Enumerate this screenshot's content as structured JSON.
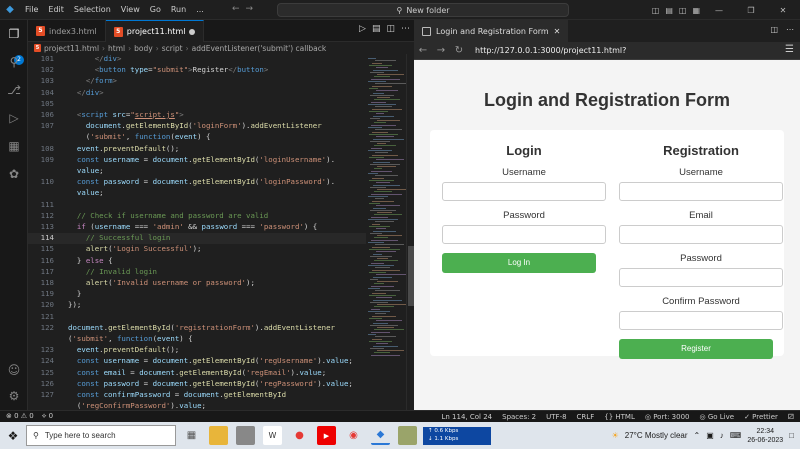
{
  "titlebar": {
    "menu": [
      "File",
      "Edit",
      "Selection",
      "View",
      "Go",
      "Run",
      "..."
    ],
    "search": "New folder"
  },
  "tabs": [
    {
      "label": "index3.html"
    },
    {
      "label": "project11.html"
    }
  ],
  "breadcrumb": [
    "project11.html",
    "html",
    "body",
    "script",
    "addEventListener('submit') callback"
  ],
  "code": {
    "lines": [
      {
        "n": "101",
        "t": ""
      },
      {
        "n": "102",
        "t": ""
      },
      {
        "n": "103",
        "t": ""
      },
      {
        "n": "104",
        "t": ""
      },
      {
        "n": "105",
        "t": ""
      },
      {
        "n": "106",
        "t": ""
      },
      {
        "n": "107",
        "t": ""
      },
      {
        "n": "",
        "t": ""
      },
      {
        "n": "108",
        "t": ""
      },
      {
        "n": "109",
        "t": ""
      },
      {
        "n": "",
        "t": ""
      },
      {
        "n": "110",
        "t": ""
      },
      {
        "n": "",
        "t": ""
      },
      {
        "n": "111",
        "t": ""
      },
      {
        "n": "112",
        "t": ""
      },
      {
        "n": "113",
        "t": ""
      },
      {
        "n": "114",
        "t": ""
      },
      {
        "n": "115",
        "t": ""
      },
      {
        "n": "116",
        "t": ""
      },
      {
        "n": "117",
        "t": ""
      },
      {
        "n": "118",
        "t": ""
      },
      {
        "n": "119",
        "t": ""
      },
      {
        "n": "120",
        "t": ""
      },
      {
        "n": "121",
        "t": ""
      },
      {
        "n": "122",
        "t": ""
      },
      {
        "n": "",
        "t": ""
      },
      {
        "n": "123",
        "t": ""
      },
      {
        "n": "124",
        "t": ""
      },
      {
        "n": "125",
        "t": ""
      },
      {
        "n": "126",
        "t": ""
      },
      {
        "n": "127",
        "t": ""
      },
      {
        "n": "",
        "t": ""
      }
    ]
  },
  "browser": {
    "tab_title": "Login and Registration Form",
    "url": "http://127.0.0.1:3000/project11.html?"
  },
  "form_page": {
    "title": "Login and Registration Form",
    "login": {
      "heading": "Login",
      "username_label": "Username",
      "password_label": "Password",
      "button": "Log In"
    },
    "registration": {
      "heading": "Registration",
      "username_label": "Username",
      "email_label": "Email",
      "password_label": "Password",
      "confirm_label": "Confirm Password",
      "button": "Register"
    }
  },
  "statusbar": {
    "errors": "0",
    "warnings": "0",
    "ports": "0",
    "position": "Ln 114, Col 24",
    "spaces": "Spaces: 2",
    "encoding": "UTF-8",
    "eol": "CRLF",
    "language": "HTML",
    "port": "Port: 3000",
    "golive": "Go Live",
    "prettier": "Prettier"
  },
  "taskbar": {
    "search_placeholder": "Type here to search",
    "net_up": "0.6 Kbps",
    "net_down": "1.1 Kbps",
    "weather": "27°C  Mostly clear",
    "time": "22:34",
    "date": "26-06-2023"
  },
  "colors": {
    "accent": "#0078d4",
    "button_green": "#4caf50",
    "editor_bg": "#1f1f1f"
  }
}
